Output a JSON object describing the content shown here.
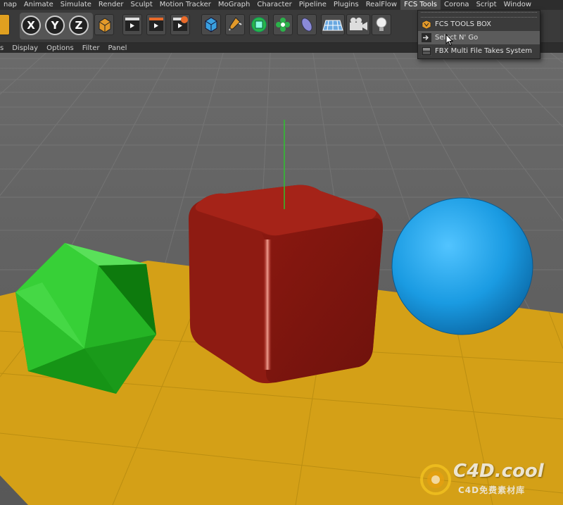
{
  "menubar": {
    "items": [
      "nap",
      "Animate",
      "Simulate",
      "Render",
      "Sculpt",
      "Motion Tracker",
      "MoGraph",
      "Character",
      "Pipeline",
      "Plugins",
      "RealFlow",
      "FCS Tools",
      "Corona",
      "Script",
      "Window"
    ],
    "active": "FCS Tools"
  },
  "toolbar": {
    "axis_x": "X",
    "axis_y": "Y",
    "axis_z": "Z"
  },
  "viewport_menu": {
    "items": [
      "s",
      "Display",
      "Options",
      "Filter",
      "Panel"
    ]
  },
  "dropdown": {
    "items": [
      {
        "label": "FCS TOOLS BOX",
        "icon": "fcs-toolbox-icon"
      },
      {
        "label": "Select N' Go",
        "icon": "arrow-select-icon",
        "highlighted": true
      },
      {
        "label": "FBX Multi File Takes System",
        "icon": "fbx-icon"
      }
    ]
  },
  "watermark": {
    "text": "C4D.cool",
    "subtext": "C4D免费素材库"
  },
  "colors": {
    "menubar_bg": "#2d2d2d",
    "viewport_bg": "#5a5a5a",
    "floor": "#d4a017",
    "cube": "#a01a10",
    "sphere": "#1e9ee0",
    "icosahedron": "#22c322"
  }
}
